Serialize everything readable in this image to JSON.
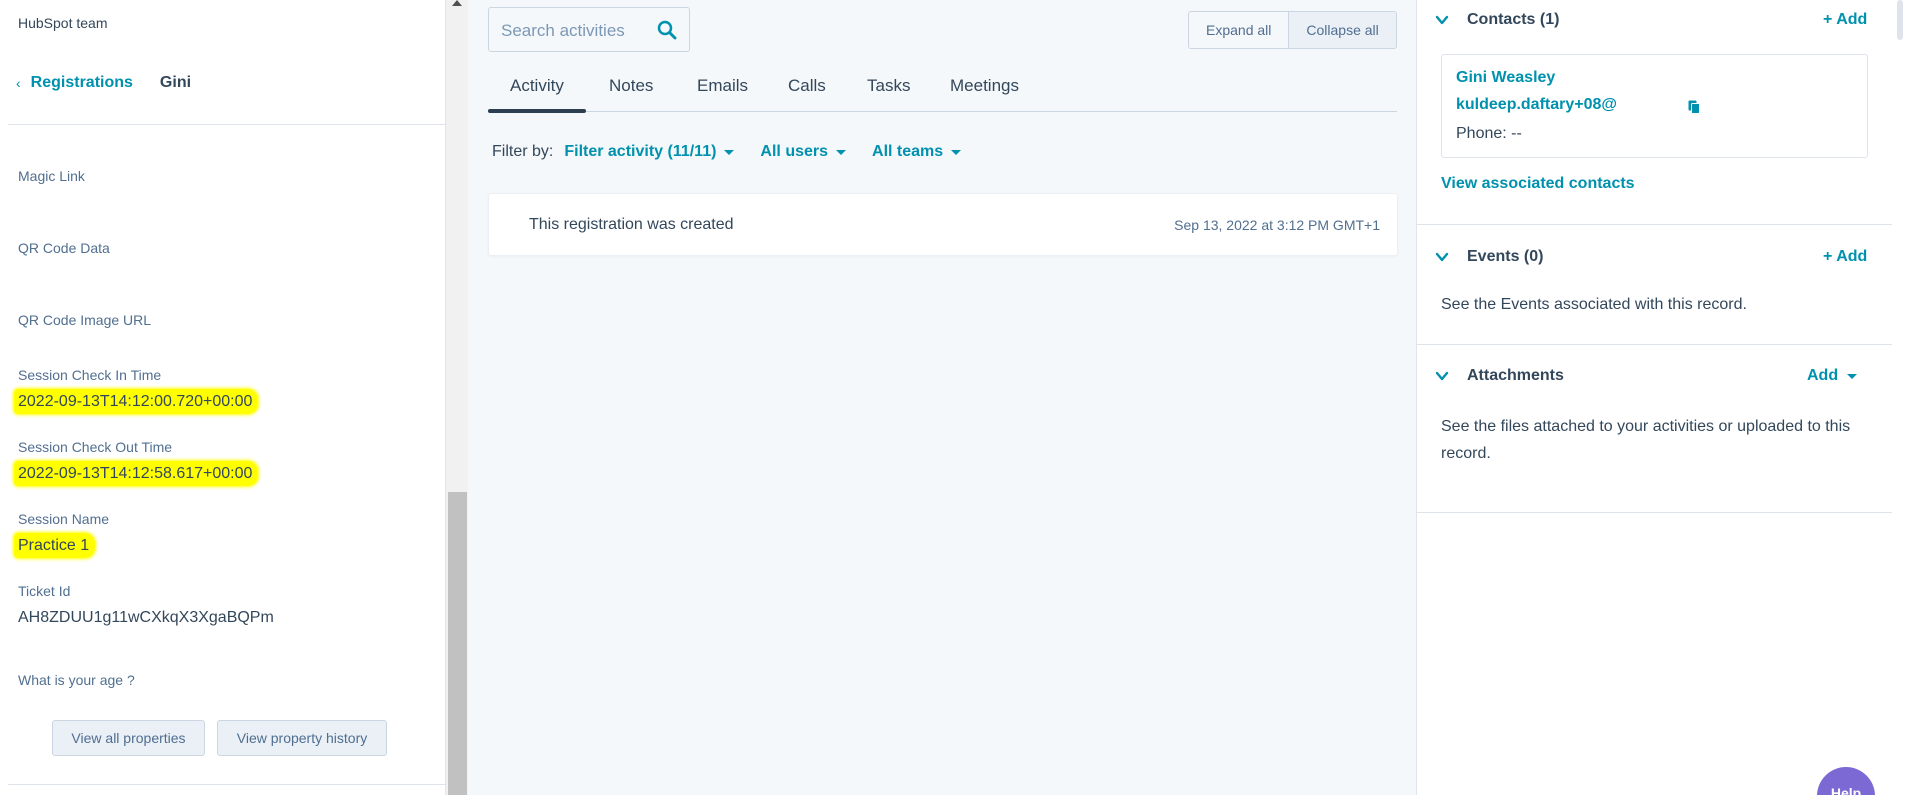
{
  "left_panel": {
    "team_label": "HubSpot team",
    "breadcrumb": {
      "back_chevron": "‹",
      "link": "Registrations",
      "current": "Gini"
    },
    "properties": [
      {
        "label": "Magic Link",
        "value": ""
      },
      {
        "label": "QR Code Data",
        "value": ""
      },
      {
        "label": "QR Code Image URL",
        "value": ""
      },
      {
        "label": "Session Check In Time",
        "value": "2022-09-13T14:12:00.720+00:00"
      },
      {
        "label": "Session Check Out Time",
        "value": "2022-09-13T14:12:58.617+00:00"
      },
      {
        "label": "Session Name",
        "value": "Practice 1"
      },
      {
        "label": "Ticket Id",
        "value": "AH8ZDUU1g11wCXkqX3XgaBQPm"
      },
      {
        "label": "What is your age ?",
        "value": ""
      }
    ],
    "buttons": {
      "view_all": "View all properties",
      "view_history": "View property history"
    },
    "highlight_color": "#ffff00"
  },
  "middle_panel": {
    "search": {
      "placeholder": "Search activities",
      "icon": "search-icon"
    },
    "expand_all": "Expand all",
    "collapse_all": "Collapse all",
    "tabs": [
      "Activity",
      "Notes",
      "Emails",
      "Calls",
      "Tasks",
      "Meetings"
    ],
    "active_tab": "Activity",
    "filter": {
      "label": "Filter by:",
      "activity": "Filter activity (11/11)",
      "users": "All users",
      "teams": "All teams"
    },
    "activity": {
      "text": "This registration was created",
      "timestamp": "Sep 13, 2022 at 3:12 PM GMT+1"
    }
  },
  "right_panel": {
    "contacts": {
      "title": "Contacts (1)",
      "add": "+ Add",
      "contact": {
        "name": "Gini Weasley",
        "email": "kuldeep.daftary+08@",
        "phone": "Phone: --"
      },
      "view_link": "View associated contacts"
    },
    "events": {
      "title": "Events (0)",
      "add": "+ Add",
      "description": "See the Events associated with this record."
    },
    "attachments": {
      "title": "Attachments",
      "add": "Add",
      "description": "See the files attached to your activities or uploaded to this record."
    },
    "help_button": "Help"
  },
  "colors": {
    "accent": "#0091ae",
    "text": "#33475b",
    "muted": "#516f90",
    "panel_bg": "#f5f8fa",
    "help": "#7c69d4"
  }
}
